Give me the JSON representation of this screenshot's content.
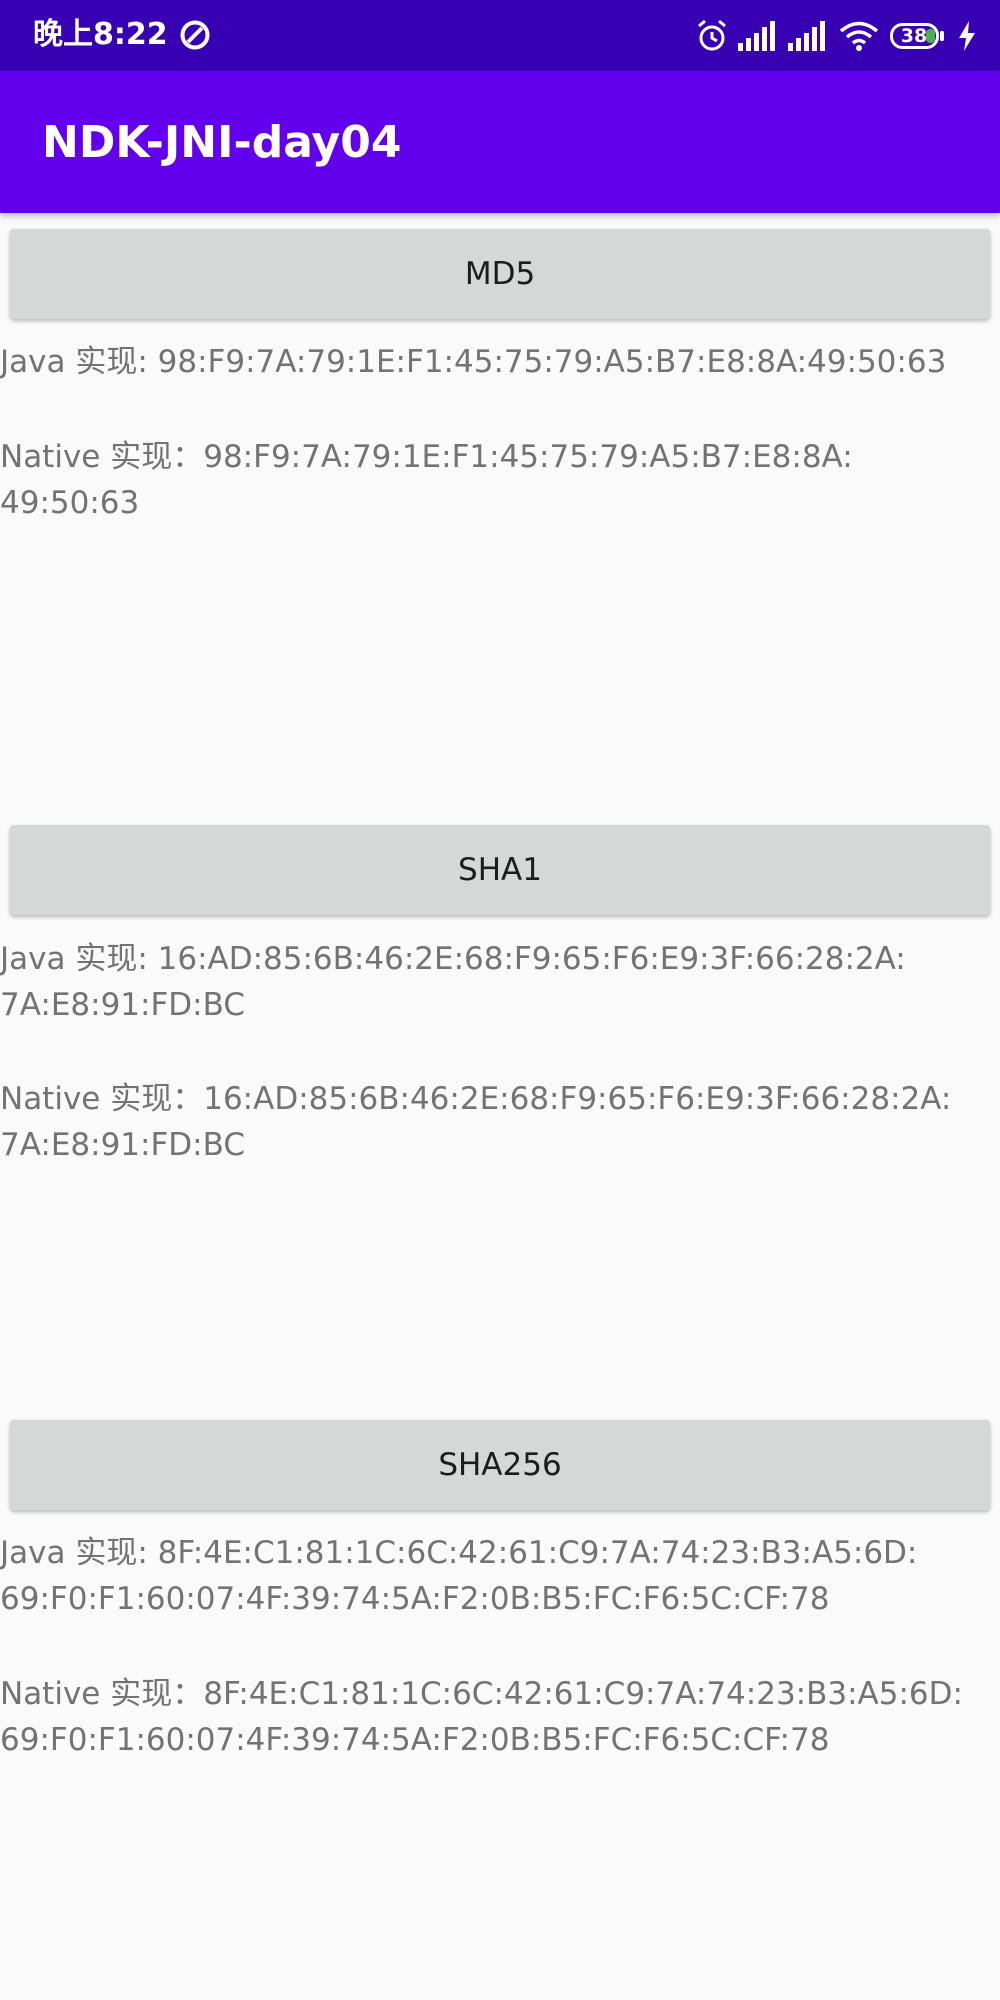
{
  "status_bar": {
    "time": "晚上8:22",
    "left_icon": "data-saver-icon",
    "icons": [
      "alarm-icon",
      "signal-icon",
      "signal-icon",
      "wifi-icon",
      "battery-icon",
      "charging-icon"
    ],
    "battery_level": "38",
    "background": "#3700b3"
  },
  "app_bar": {
    "title": "NDK-JNI-day04",
    "background": "#6200ee"
  },
  "sections": {
    "md5": {
      "button_label": "MD5",
      "java_result": "Java 实现: 98:F9:7A:79:1E:F1:45:75:79:A5:B7:E8:8A:49:50:63",
      "native_result": "Native 实现：98:F9:7A:79:1E:F1:45:75:79:A5:B7:E8:8A:\n49:50:63"
    },
    "sha1": {
      "button_label": "SHA1",
      "java_result": "Java 实现: 16:AD:85:6B:46:2E:68:F9:65:F6:E9:3F:66:28:2A:\n7A:E8:91:FD:BC",
      "native_result": "Native 实现：16:AD:85:6B:46:2E:68:F9:65:F6:E9:3F:66:28:2A:\n7A:E8:91:FD:BC"
    },
    "sha256": {
      "button_label": "SHA256",
      "java_result": "Java 实现: 8F:4E:C1:81:1C:6C:42:61:C9:7A:74:23:B3:A5:6D:\n69:F0:F1:60:07:4F:39:74:5A:F2:0B:B5:FC:F6:5C:CF:78",
      "native_result": "Native 实现：8F:4E:C1:81:1C:6C:42:61:C9:7A:74:23:B3:A5:6D:\n69:F0:F1:60:07:4F:39:74:5A:F2:0B:B5:FC:F6:5C:CF:78"
    }
  },
  "colors": {
    "button_background": "#d6d7d7",
    "result_text": "#737373",
    "page_background": "#fafafa"
  }
}
